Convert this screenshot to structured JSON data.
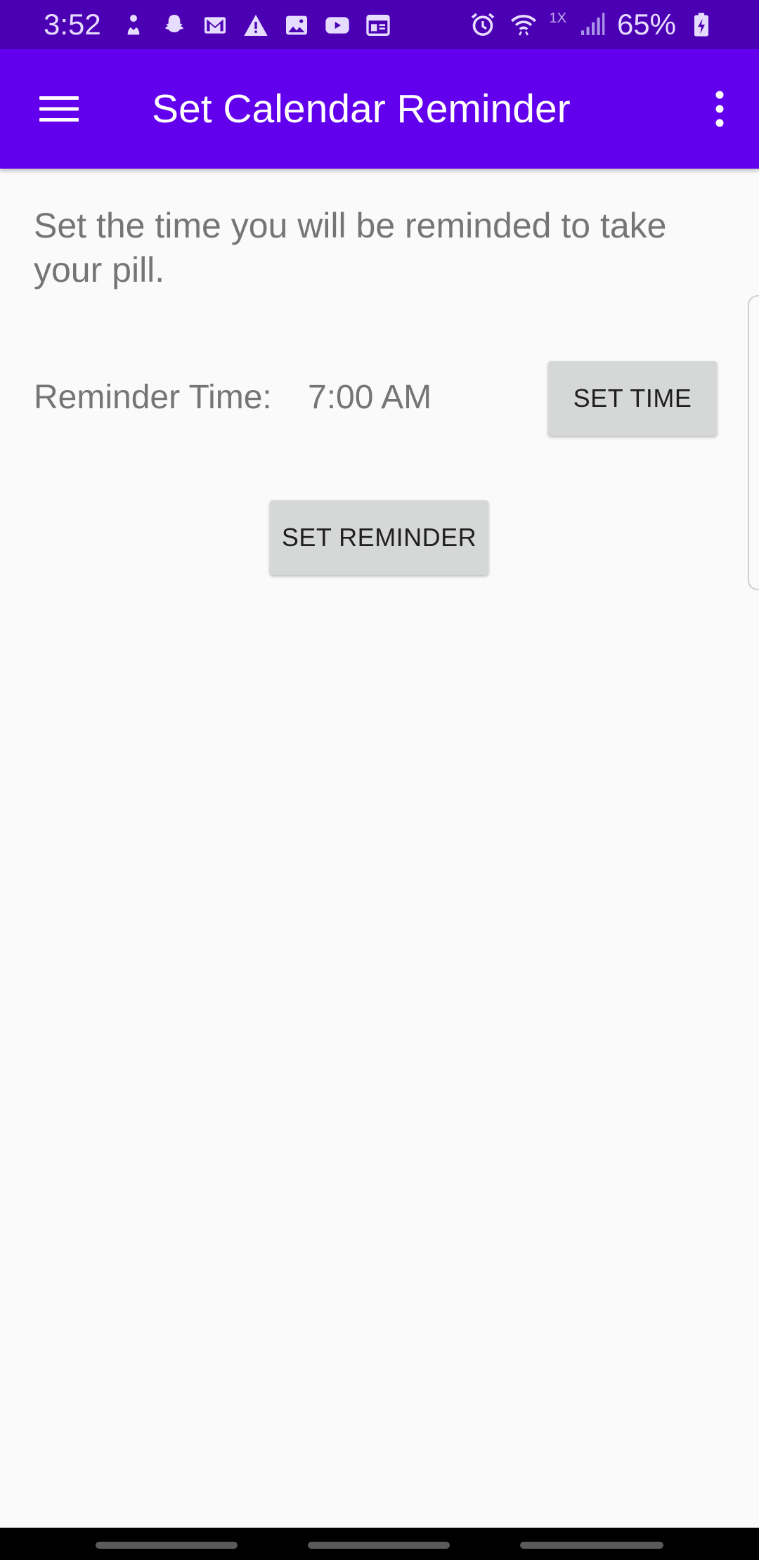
{
  "status_bar": {
    "time": "3:52",
    "battery_percent": "65%",
    "network_label": "1X",
    "left_icons": [
      "upload-person-icon",
      "snapchat-icon",
      "gmail-icon",
      "warning-icon",
      "gallery-icon",
      "youtube-icon",
      "calendar-news-icon"
    ],
    "right_icons": [
      "alarm-icon",
      "wifi-icon",
      "signal-icon",
      "battery-charging-icon"
    ]
  },
  "app_bar": {
    "title": "Set Calendar Reminder",
    "menu_icon": "hamburger-menu-icon",
    "overflow_icon": "more-vert-icon",
    "background": "#6200ee"
  },
  "content": {
    "instruction": "Set the time you will be reminded to take your pill.",
    "reminder_label": "Reminder Time:",
    "reminder_time": "7:00 AM",
    "set_time_button": "SET TIME",
    "set_reminder_button": "SET REMINDER"
  },
  "colors": {
    "status_bar": "#4c00b3",
    "app_bar": "#6200ee",
    "button": "#d6d7d7",
    "body_text": "#757575",
    "background": "#fafafa"
  }
}
